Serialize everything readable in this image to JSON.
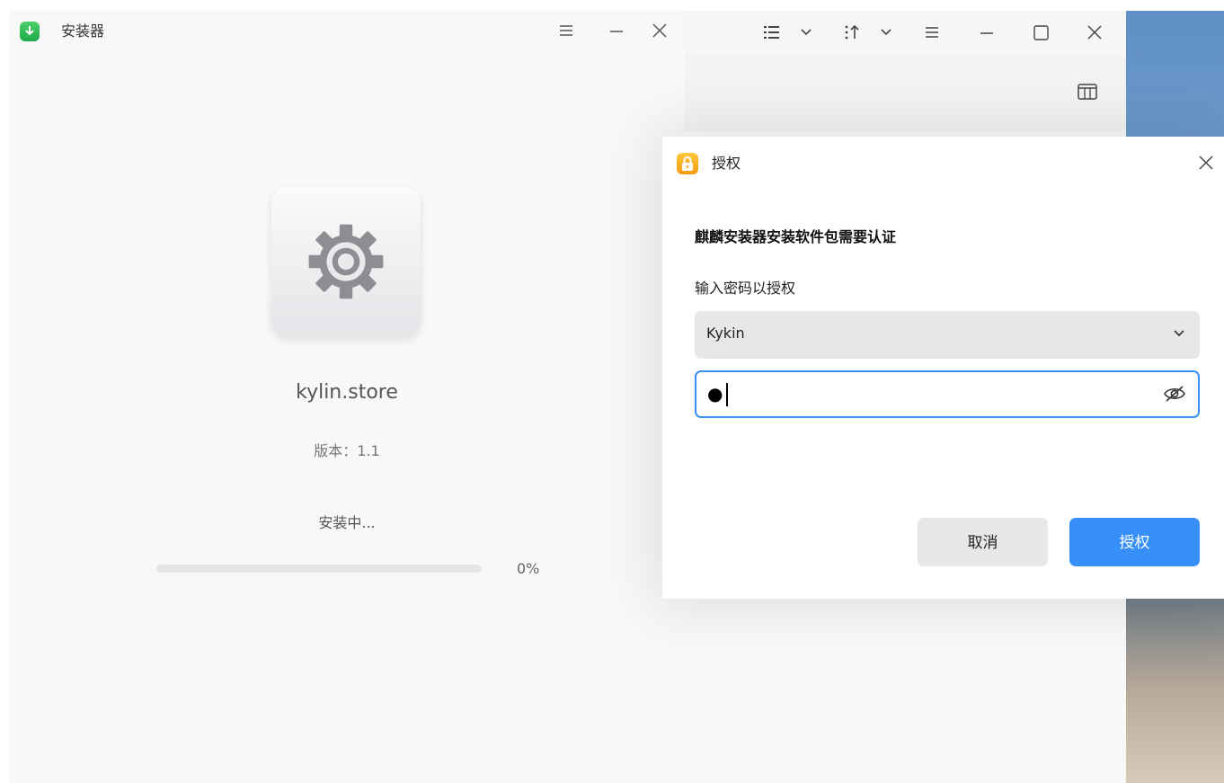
{
  "installer": {
    "title": "安装器",
    "menu_icon": "menu-icon",
    "minimize_icon": "minimize-icon",
    "close_icon": "close-icon",
    "package": {
      "icon": "gear-icon",
      "name": "kylin.store",
      "version": "版本：1.1"
    },
    "status": "安装中...",
    "progress": {
      "value": 0,
      "label": "0%",
      "color": "#3790fa"
    }
  },
  "file_manager": {
    "toolbar_icons": [
      "list-view-icon",
      "chevron-down-icon",
      "sort-icon",
      "chevron-down-icon",
      "menu-icon",
      "minimize-icon",
      "maximize-icon",
      "close-icon"
    ],
    "column_icon": "columns-icon"
  },
  "auth_dialog": {
    "title": "授权",
    "heading": "麒麟安装器安装软件包需要认证",
    "subtitle": "输入密码以授权",
    "user": "Kykin",
    "password_mask": "●",
    "cancel_label": "取消",
    "ok_label": "授权",
    "accent": "#3790fa"
  }
}
